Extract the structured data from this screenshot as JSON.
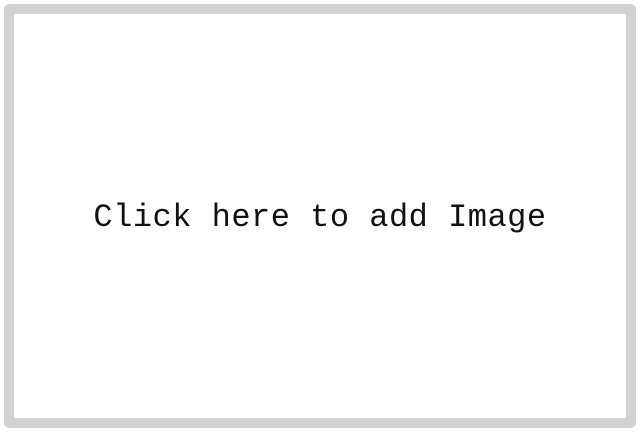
{
  "image_placeholder": {
    "label": "Click here to add Image",
    "border_color": "#d2d2d2",
    "background_color": "#ffffff"
  }
}
